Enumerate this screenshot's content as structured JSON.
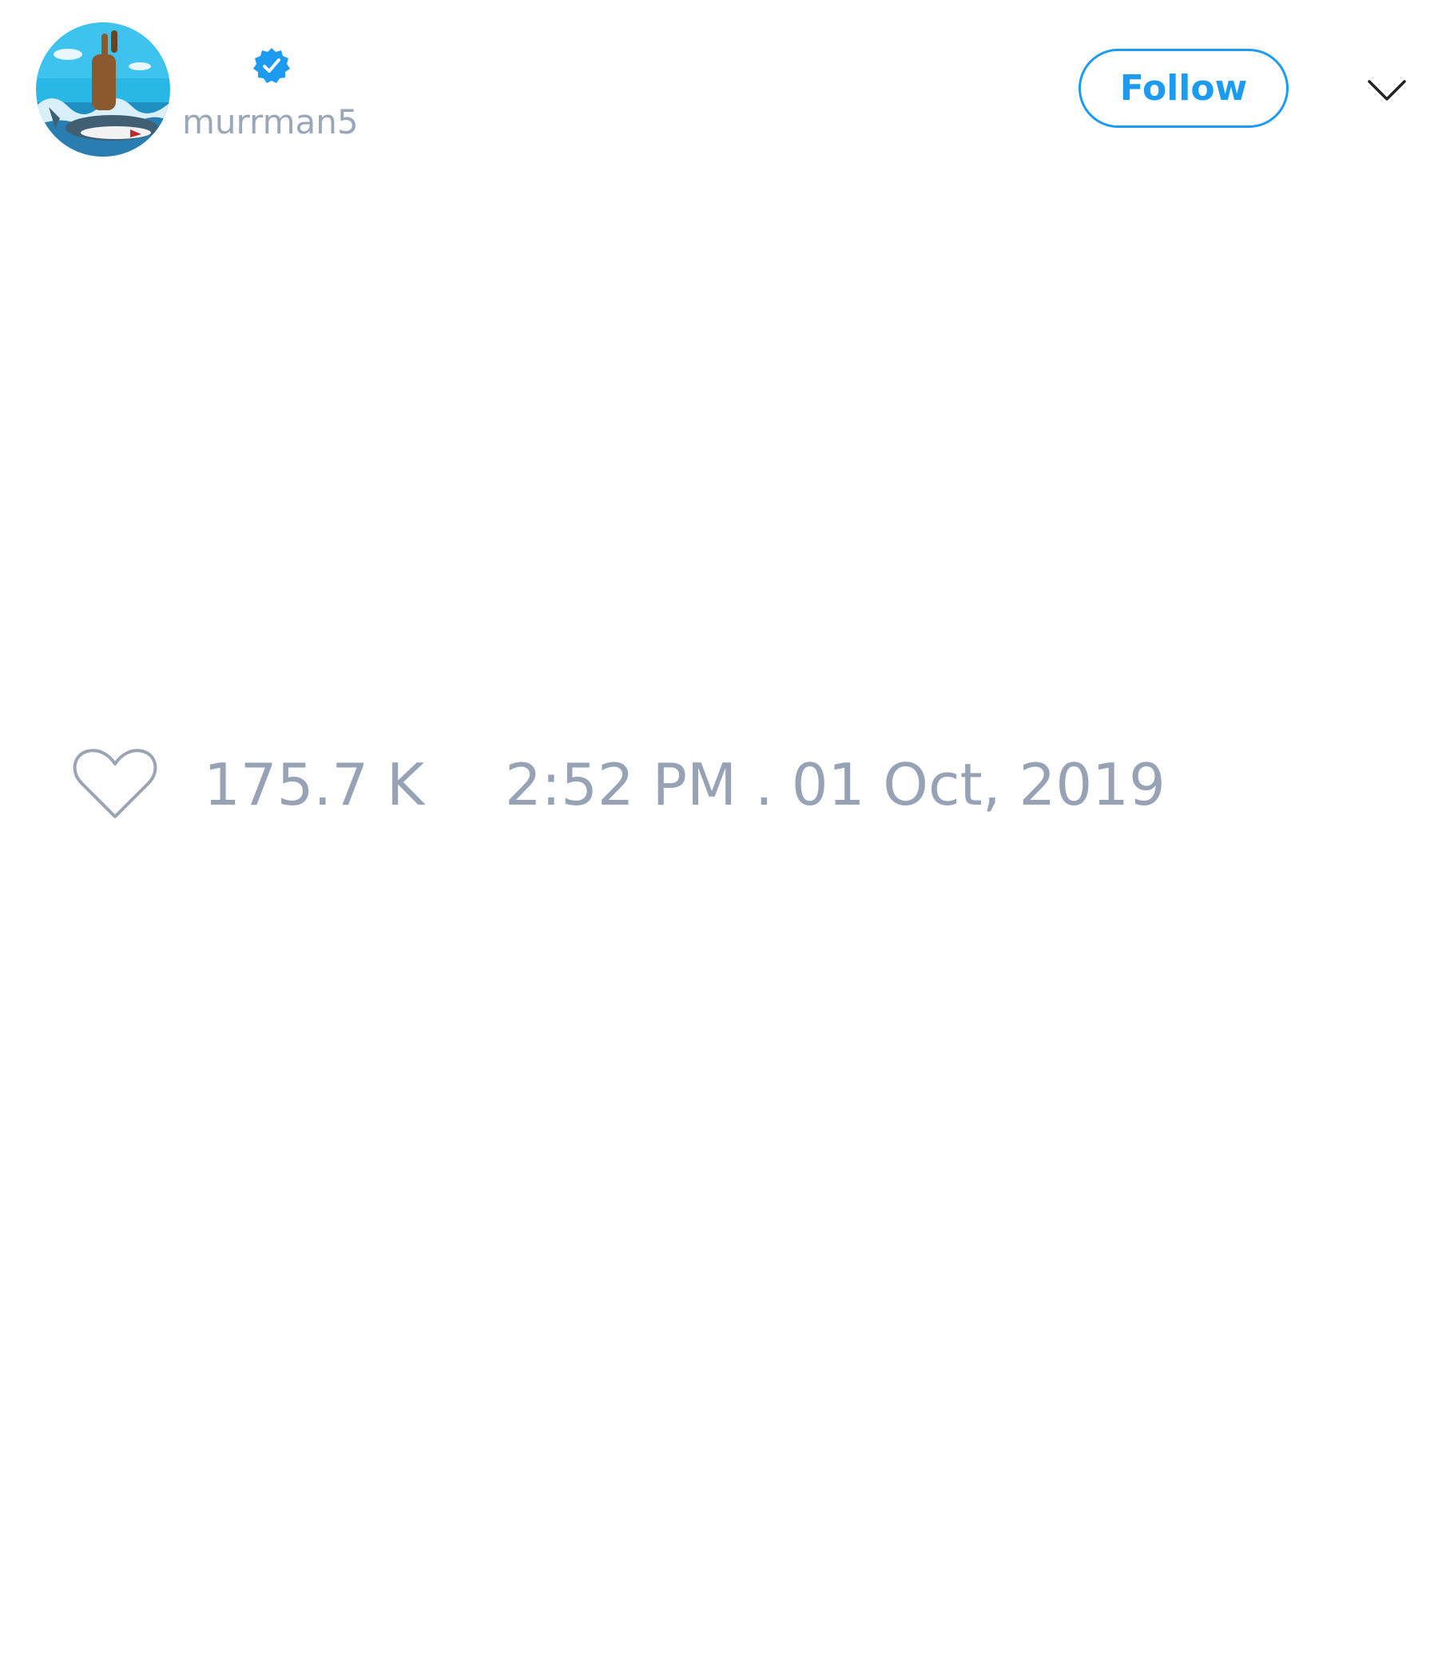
{
  "author": {
    "handle": "murrman5",
    "verified": true,
    "avatar_icon": "bear-riding-shark-avatar"
  },
  "header": {
    "follow_label": "Follow",
    "more_icon": "chevron-down-icon"
  },
  "engagement": {
    "like_icon": "heart-outline-icon",
    "like_count": "175.7 K",
    "timestamp": "2:52 PM . 01 Oct, 2019"
  },
  "colors": {
    "accent": "#1d9bf0",
    "muted_text": "#97a3b5",
    "background": "#ffffff"
  }
}
